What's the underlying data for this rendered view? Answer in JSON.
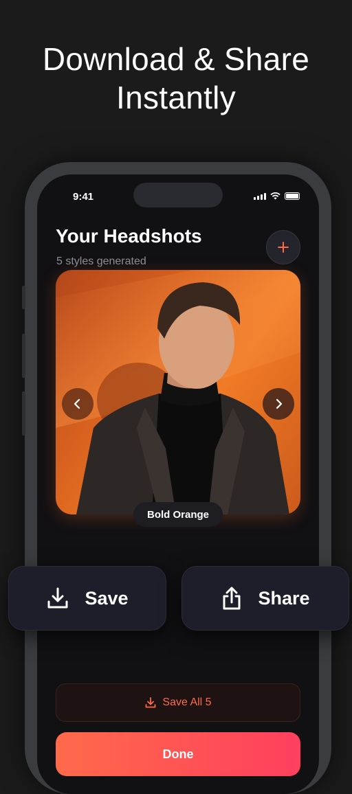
{
  "hero": {
    "line1": "Download & Share",
    "line2": "Instantly"
  },
  "status_bar": {
    "time": "9:41"
  },
  "header": {
    "title": "Your Headshots",
    "subtitle": "5 styles generated"
  },
  "carousel": {
    "style_label": "Bold Orange"
  },
  "actions": {
    "save_label": "Save",
    "share_label": "Share"
  },
  "footer": {
    "save_all_label": "Save All 5",
    "done_label": "Done"
  },
  "colors": {
    "accent": "#ff6a4a",
    "accent_gradient_end": "#ff3f5e",
    "background": "#1b1b1c",
    "card": "#1e1e2a"
  },
  "icons": [
    "plus-icon",
    "chevron-left-icon",
    "chevron-right-icon",
    "download-icon",
    "share-icon",
    "signal-icon",
    "wifi-icon",
    "battery-icon"
  ]
}
